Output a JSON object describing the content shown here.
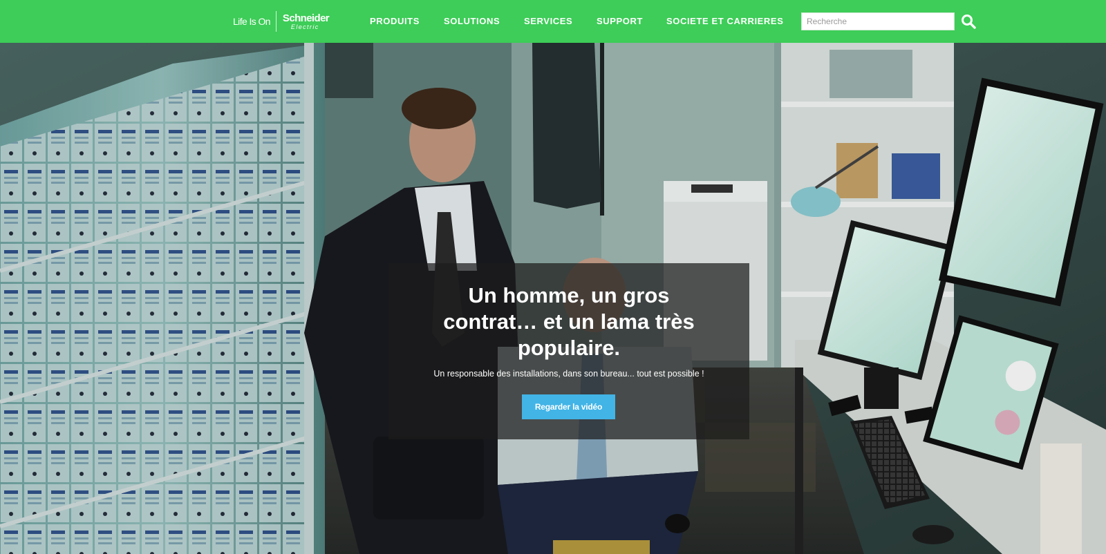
{
  "header": {
    "tagline": "Life Is On",
    "brand_top": "Schneider",
    "brand_bottom": "Electric",
    "nav": [
      {
        "label": "PRODUITS"
      },
      {
        "label": "SOLUTIONS"
      },
      {
        "label": "SERVICES"
      },
      {
        "label": "SUPPORT"
      },
      {
        "label": "SOCIETE ET CARRIERES"
      }
    ],
    "search_placeholder": "Recherche",
    "search_icon": "search-icon",
    "accent": "#3dcd58"
  },
  "hero": {
    "headline": "Un homme, un gros contrat… et un lama très populaire.",
    "subline": "Un responsable des installations, dans son bureau... tout est possible !",
    "cta_label": "Regarder la vidéo",
    "cta_color": "#42b4e6"
  }
}
